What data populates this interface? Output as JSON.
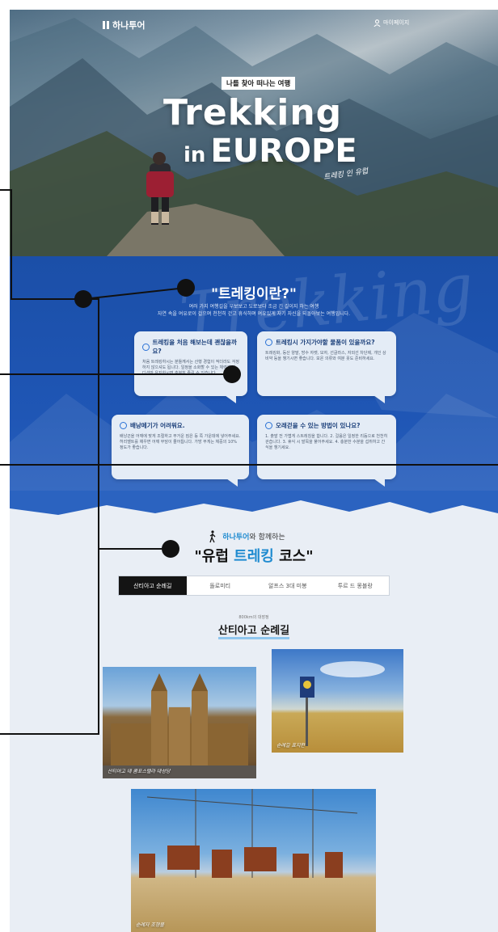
{
  "header": {
    "logo_text": "하나투어",
    "mypage_label": "마이페이지"
  },
  "hero": {
    "tagline": "나를 찾아 떠나는 여행",
    "title_line1": "Trekking",
    "title_in": "in",
    "title_line2": "EUROPE",
    "script_caption": "트레킹 인 유럽"
  },
  "about": {
    "bg_script": "Trekking",
    "title": "\"트레킹이란?\"",
    "subtitle_line1": "여러 가지 여행길을 우보보고 도로보다 조금 긴 길이지 하는 여행",
    "subtitle_line2": "자연 속을 여유로이 걸으며 천천히 걷고 휴식하며 여유있게 자기 자신을 되돌아보는 여행입니다.",
    "bubbles": [
      {
        "question": "트레킹을 처음 해보는데 괜찮을까요?",
        "answer": "처음 트레킹하시는 분들께서는 산행 경험이 적더라도 걱정하지 않으셔도 됩니다. 일정을 소화할 수 있는 체력과 컨디션만 유지하시면 충분히 즐길 수 있습니다."
      },
      {
        "question": "트레킹시 가지가야할 물품이 있을까요?",
        "answer": "트레킹화, 등산 양말, 방수 자켓, 모자, 선글라스, 자외선 차단제, 개인 상비약 등을 챙기시면 좋습니다. 보온 의류와 여분 옷도 준비하세요."
      },
      {
        "question": "배낭메기가 어려워요.",
        "answer": "배낭끈을 어깨에 맞게 조절하고 무거운 짐은 등 쪽 가운데에 넣어주세요. 허리벨트를 채우면 어깨 부담이 줄어듭니다. 가방 무게는 체중의 10% 정도가 좋습니다."
      },
      {
        "question": "오래걷을 수 있는 방법이 있나요?",
        "answer": "1. 출발 전 가볍게 스트레칭을 합니다. 2. 걸음은 일정한 리듬으로 천천히 걷습니다. 3. 휴식 시 발목을 풀어주세요. 4. 충분한 수분을 섭취하고 간식을 챙기세요."
      }
    ]
  },
  "courses": {
    "pre_brand": "하나투어",
    "pre_rest": "와 함께하는",
    "title_a": "\"유럽 ",
    "title_hl": "트레킹",
    "title_b": " 코스\"",
    "tabs": [
      "산티아고 순례길",
      "돌로미티",
      "알프스 3대 미봉",
      "투르 드 몽블랑"
    ],
    "active_tab": 0,
    "route_sub": "800km의 대장정",
    "route_title": "산티아고 순례길",
    "photos": [
      {
        "caption": "산티아고 데 콤포스텔라 대성당"
      },
      {
        "caption": "순례길 표지판"
      },
      {
        "caption": "순례자 조형물"
      }
    ]
  },
  "colors": {
    "brand_blue": "#1f56b5",
    "accent_cyan": "#1f8bd0",
    "tab_active_bg": "#141414"
  }
}
